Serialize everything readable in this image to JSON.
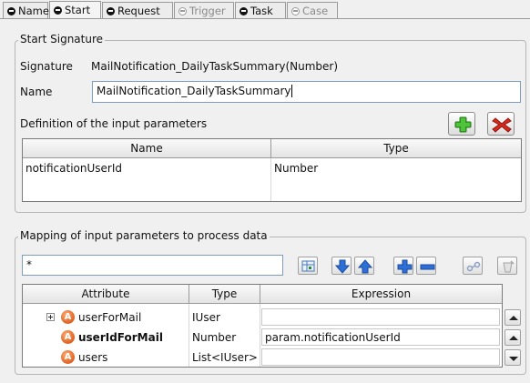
{
  "tabs": [
    {
      "label": "Name",
      "enabled": true
    },
    {
      "label": "Start",
      "enabled": true,
      "active": true
    },
    {
      "label": "Request",
      "enabled": true
    },
    {
      "label": "Trigger",
      "enabled": false
    },
    {
      "label": "Task",
      "enabled": true
    },
    {
      "label": "Case",
      "enabled": false
    }
  ],
  "start_signature": {
    "group_title": "Start Signature",
    "signature_label": "Signature",
    "signature_value": "MailNotification_DailyTaskSummary(Number)",
    "name_label": "Name",
    "name_value": "MailNotification_DailyTaskSummary",
    "definition_label": "Definition of the input parameters",
    "add_icon": "green-plus-icon",
    "remove_icon": "red-x-icon",
    "table_headers": [
      "Name",
      "Type"
    ],
    "rows": [
      {
        "name": "notificationUserId",
        "type": "Number"
      }
    ]
  },
  "mapping": {
    "group_title": "Mapping of input parameters to process data",
    "filter_value": "*",
    "toolbar_icons": [
      "table-view-icon",
      "move-down-icon",
      "move-up-icon",
      "add-icon",
      "remove-icon",
      "link-icon",
      "delete-icon"
    ],
    "table_headers": [
      "Attribute",
      "Type",
      "Expression"
    ],
    "rows": [
      {
        "attribute": "userForMail",
        "type": "IUser",
        "expression": "",
        "expandable": true,
        "bold": false
      },
      {
        "attribute": "userIdForMail",
        "type": "Number",
        "expression": "param.notificationUserId",
        "expandable": false,
        "bold": true
      },
      {
        "attribute": "users",
        "type": "List<IUser>",
        "expression": "",
        "expandable": false,
        "bold": false
      }
    ]
  },
  "colors": {
    "attr_icon": "#e0601f",
    "add_green": "#3cae2a",
    "remove_red": "#d8281c",
    "arrow_blue": "#2d6fd6"
  }
}
